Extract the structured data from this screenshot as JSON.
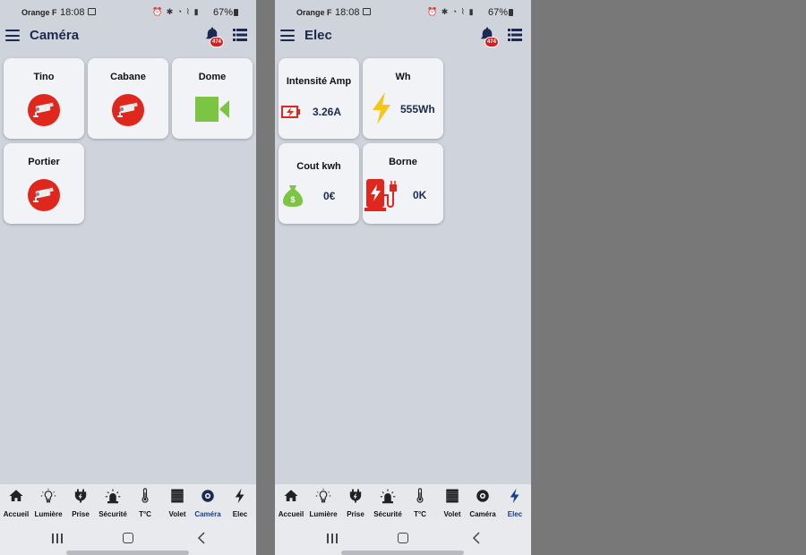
{
  "colors": {
    "accent": "#1b2a4e",
    "red": "#e0271d",
    "green": "#7cc444",
    "yellow": "#f5c518",
    "badge": "#d32020"
  },
  "screens": [
    {
      "status": {
        "carrier": "Orange F",
        "time": "18:08",
        "battery": "67%"
      },
      "title": "Caméra",
      "badge": "474",
      "tiles": [
        {
          "title": "Tino",
          "icon": "security-camera-icon"
        },
        {
          "title": "Cabane",
          "icon": "security-camera-icon"
        },
        {
          "title": "Dome",
          "icon": "video-camera-icon"
        },
        {
          "title": "Portier",
          "icon": "security-camera-icon"
        }
      ]
    },
    {
      "status": {
        "carrier": "Orange F",
        "time": "18:08",
        "battery": "67%"
      },
      "title": "Elec",
      "badge": "474",
      "tiles": [
        {
          "title": "Intensité Amp",
          "value": "3.26A",
          "icon": "battery-charging-icon"
        },
        {
          "title": "Wh",
          "value": "555Wh",
          "icon": "lightning-icon"
        },
        {
          "title": "Cout kwh",
          "value": "0€",
          "icon": "money-bag-icon"
        },
        {
          "title": "Borne",
          "value": "0K",
          "icon": "ev-charger-icon"
        }
      ]
    }
  ],
  "nav": [
    "Accueil",
    "Lumière",
    "Prise",
    "Sécurité",
    "T°C",
    "Volet",
    "Caméra",
    "Elec"
  ]
}
